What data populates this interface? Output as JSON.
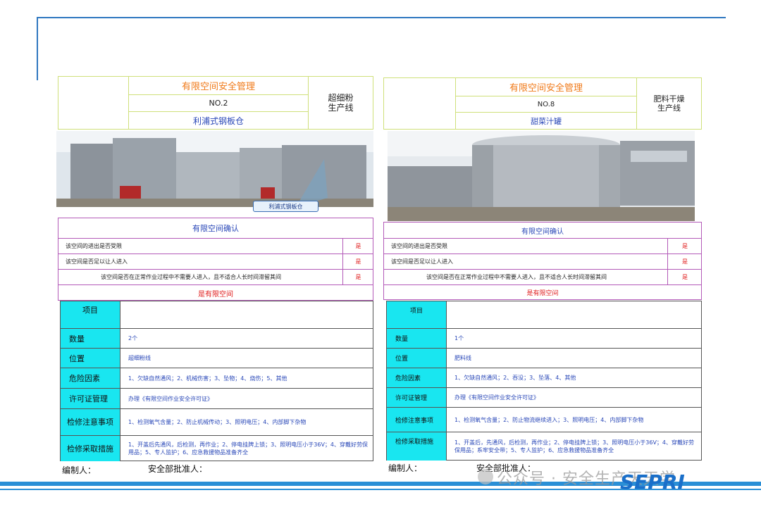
{
  "left": {
    "header_title": "有限空间安全管理",
    "number": "NO.2",
    "name": "利浦式钢板仓",
    "line": "超细粉\n生产线",
    "callout": "利浦式钢板仓",
    "confirm_title": "有限空间确认",
    "confirm_rows": [
      {
        "q": "该空间的进出是否受限",
        "a": "是"
      },
      {
        "q": "该空间是否足以让人进入",
        "a": "是"
      },
      {
        "q": "该空间是否在正常作业过程中不需要人进入，且不适合人长时间滞留其间",
        "a": "是"
      }
    ],
    "confirm_result": "是有限空间",
    "info": [
      {
        "k": "项目",
        "v": ""
      },
      {
        "k": "数量",
        "v": "2个"
      },
      {
        "k": "位置",
        "v": "超细粉线"
      },
      {
        "k": "危险因素",
        "v": "1、欠缺自然通风；2、机械伤害；3、坠物；4、烧伤；5、其他"
      },
      {
        "k": "许可证管理",
        "v": "办理《有限空间作业安全许可证》"
      },
      {
        "k": "检修注意事项",
        "v": "1、检测氧气含量；2、防止机械传动；3、照明电压；4、内部脚下杂物"
      },
      {
        "k": "检修采取措施",
        "v": "1、开盖后先通风，后检测，再作业；2、停电挂牌上锁；3、照明电压小于36V；4、穿戴好劳保用品；5、专人监护；6、应急救援物品准备齐全"
      }
    ],
    "prepared_by": "编制人：",
    "approved_by": "安全部批准人："
  },
  "right": {
    "header_title": "有限空间安全管理",
    "number": "NO.8",
    "name": "甜菜汁罐",
    "line": "肥料干燥\n生产线",
    "confirm_title": "有限空间确认",
    "confirm_rows": [
      {
        "q": "该空间的进出是否受限",
        "a": "是"
      },
      {
        "q": "该空间是否足以让人进入",
        "a": "是"
      },
      {
        "q": "该空间是否在正常作业过程中不需要人进入，且不适合人长时间滞留其间",
        "a": "是"
      }
    ],
    "confirm_result": "是有限空间",
    "info": [
      {
        "k": "项目",
        "v": ""
      },
      {
        "k": "数量",
        "v": "1个"
      },
      {
        "k": "位置",
        "v": "肥料线"
      },
      {
        "k": "危险因素",
        "v": "1、欠缺自然通风；2、吞没；3、坠落、4、其他"
      },
      {
        "k": "许可证管理",
        "v": "办理《有限空间作业安全许可证》"
      },
      {
        "k": "检修注意事项",
        "v": "1、检测氧气含量；2、防止物流继续进入；3、照明电压；4、内部脚下杂物"
      },
      {
        "k": "检修采取措施",
        "v": "1、开盖后，先通风，后检测，再作业；2、停电挂牌上锁；3、照明电压小于36V；4、穿戴好劳保用品；系牢安全带；5、专人监护；6、应急救援物品准备齐全"
      }
    ],
    "prepared_by": "编制人：",
    "approved_by": "安全部批准人："
  },
  "watermark": "公众号 · 安全生产天天学",
  "logo": "SEPRI",
  "colors": {
    "accent_bar": "#2a8fd6",
    "key_cell": "#19e6f0",
    "orange": "#f07a1a",
    "answer_red": "#e02020"
  }
}
